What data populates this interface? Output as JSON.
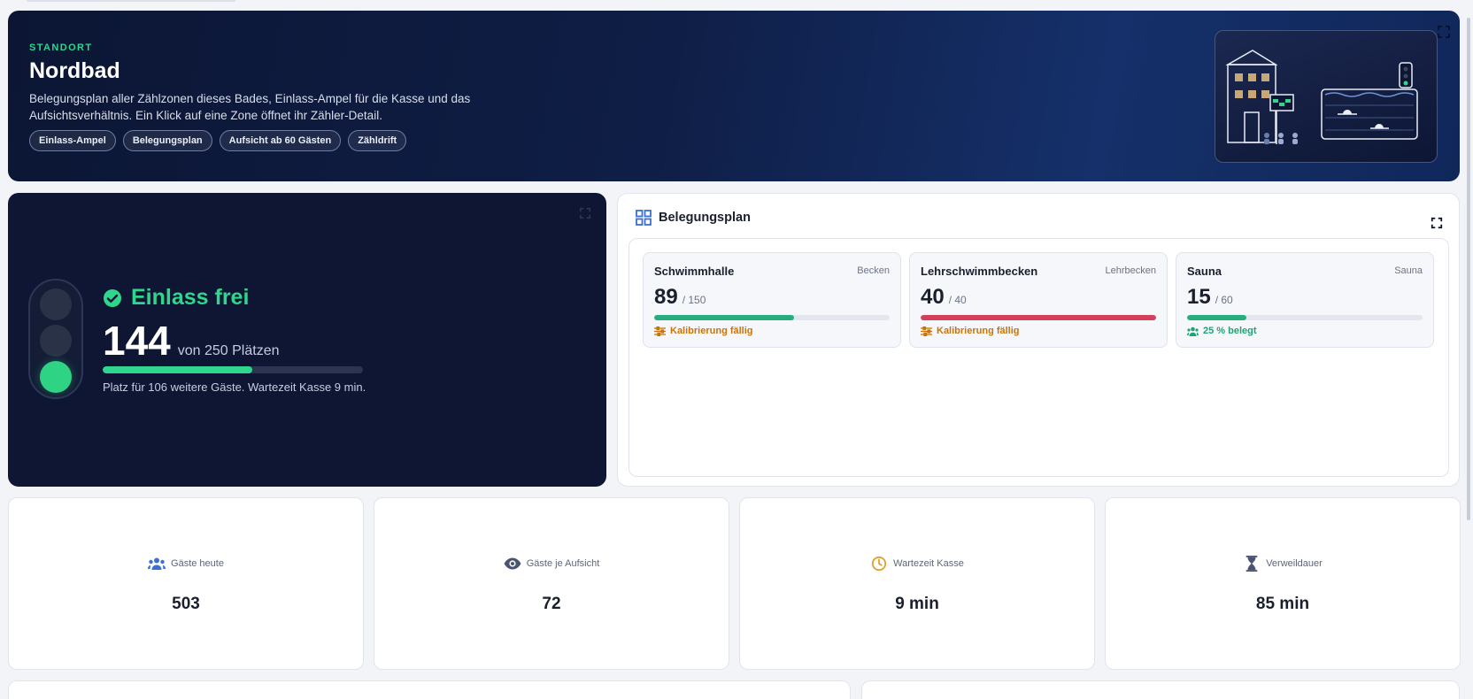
{
  "hero": {
    "label": "STANDORT",
    "title": "Nordbad",
    "description": "Belegungsplan aller Zählzonen dieses Bades, Einlass-Ampel für die Kasse und das Aufsichtsverhältnis. Ein Klick auf eine Zone öffnet ihr Zähler-Detail.",
    "chips": [
      "Einlass-Ampel",
      "Belegungsplan",
      "Aufsicht ab 60 Gästen",
      "Zähldrift"
    ],
    "illustration_icon": "pool-building-illustration"
  },
  "signal": {
    "status_icon": "check-circle-icon",
    "status": "Einlass frei",
    "count": "144",
    "count_suffix": "von 250 Plätzen",
    "capacity_fraction": 0.576,
    "note": "Platz für 106 weitere Gäste. Wartezeit Kasse 9 min.",
    "active_lamp": "green",
    "colors": {
      "green": "#2fd68b",
      "panel": "#0e1634"
    }
  },
  "plan": {
    "title": "Belegungsplan",
    "zones": [
      {
        "name": "Schwimmhalle",
        "type": "Becken",
        "count": "89",
        "capacity": "/ 150",
        "fill_fraction": 0.593,
        "bar_color": "#27ad80",
        "note": "Kalibrierung fällig",
        "note_icon": "sliders-icon",
        "note_kind": "warn"
      },
      {
        "name": "Lehrschwimmbecken",
        "type": "Lehrbecken",
        "count": "40",
        "capacity": "/ 40",
        "fill_fraction": 1.0,
        "bar_color": "#d2405b",
        "note": "Kalibrierung fällig",
        "note_icon": "sliders-icon",
        "note_kind": "warn"
      },
      {
        "name": "Sauna",
        "type": "Sauna",
        "count": "15",
        "capacity": "/ 60",
        "fill_fraction": 0.25,
        "bar_color": "#27ad80",
        "note": "25 % belegt",
        "note_icon": "users-icon",
        "note_kind": "ok"
      }
    ]
  },
  "kpis": [
    {
      "icon": "users-icon",
      "icon_color": "#3b6fd4",
      "label": "Gäste heute",
      "value": "503"
    },
    {
      "icon": "eye-icon",
      "icon_color": "#4a5470",
      "label": "Gäste je Aufsicht",
      "value": "72"
    },
    {
      "icon": "clock-icon",
      "icon_color": "#e0a030",
      "label": "Wartezeit Kasse",
      "value": "9 min"
    },
    {
      "icon": "hourglass-icon",
      "icon_color": "#4a5470",
      "label": "Verweildauer",
      "value": "85 min"
    }
  ]
}
